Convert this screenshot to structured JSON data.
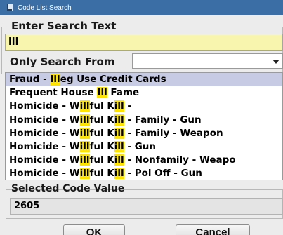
{
  "window": {
    "title": "Code List Search"
  },
  "search": {
    "label": "Enter Search Text",
    "value": "ill",
    "only_from_label": "Only Search From",
    "only_from_value": ""
  },
  "results": [
    {
      "parts": [
        "Fraud - ",
        "Ill",
        "eg Use Credit Cards"
      ],
      "selected": true
    },
    {
      "parts": [
        "Frequent House ",
        "Ill",
        " Fame"
      ],
      "selected": false
    },
    {
      "parts": [
        "Homicide - W",
        "ill",
        "ful K",
        "ill",
        " -"
      ],
      "selected": false
    },
    {
      "parts": [
        "Homicide - W",
        "ill",
        "ful K",
        "ill",
        " - Family - Gun"
      ],
      "selected": false
    },
    {
      "parts": [
        "Homicide - W",
        "ill",
        "ful K",
        "ill",
        " - Family - Weapon"
      ],
      "selected": false
    },
    {
      "parts": [
        "Homicide - W",
        "ill",
        "ful K",
        "ill",
        " - Gun"
      ],
      "selected": false
    },
    {
      "parts": [
        "Homicide - W",
        "ill",
        "ful K",
        "ill",
        " - Nonfamily - Weapo"
      ],
      "selected": false
    },
    {
      "parts": [
        "Homicide - W",
        "ill",
        "ful K",
        "ill",
        " - Pol Off - Gun"
      ],
      "selected": false
    }
  ],
  "selected_code": {
    "label": "Selected Code Value",
    "value": "2605"
  },
  "buttons": {
    "ok": "OK",
    "cancel": "Cancel"
  },
  "colors": {
    "highlight": "#ffe400",
    "selected_row": "#c7cbe4",
    "search_field": "#f7f5ae"
  }
}
